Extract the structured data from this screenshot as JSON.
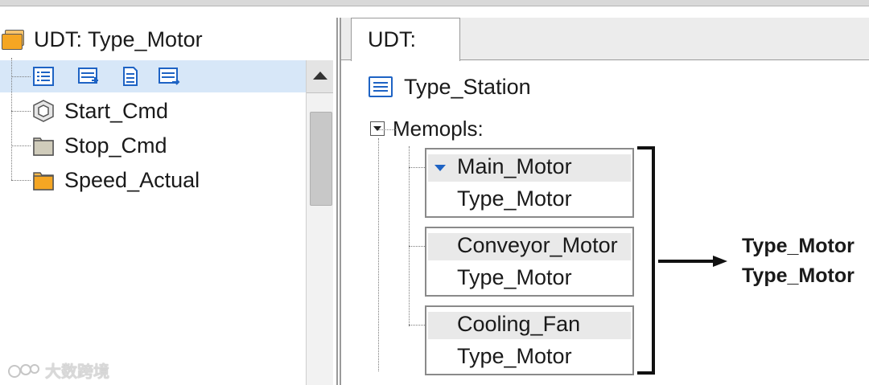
{
  "left_tree": {
    "root_label": "UDT: Type_Motor",
    "toolbar_icons": [
      "list-view-icon",
      "add-member-icon",
      "document-icon",
      "insert-member-icon"
    ],
    "items": [
      {
        "label": "Start_Cmd",
        "icon": "hexagon-icon"
      },
      {
        "label": "Stop_Cmd",
        "icon": "gray-folder-icon"
      },
      {
        "label": "Speed_Actual",
        "icon": "orange-folder-icon"
      }
    ]
  },
  "right_panel": {
    "tab_label": "UDT:",
    "type_station_label": "Type_Station",
    "members_label": "Memopls:",
    "members": [
      {
        "name": "Main_Motor",
        "type": "Type_Motor",
        "expanded": true
      },
      {
        "name": "Conveyor_Motor",
        "type": "Type_Motor",
        "expanded": false
      },
      {
        "name": "Cooling_Fan",
        "type": "Type_Motor",
        "expanded": false
      }
    ],
    "result_labels": [
      "Type_Motor",
      "Type_Motor"
    ]
  },
  "watermark": {
    "text": "大数跨境"
  },
  "colors": {
    "selection": "#d7e7f8",
    "accent": "#1e63c4",
    "folder_orange": "#f5a623",
    "folder_gray": "#d8d4c4"
  }
}
